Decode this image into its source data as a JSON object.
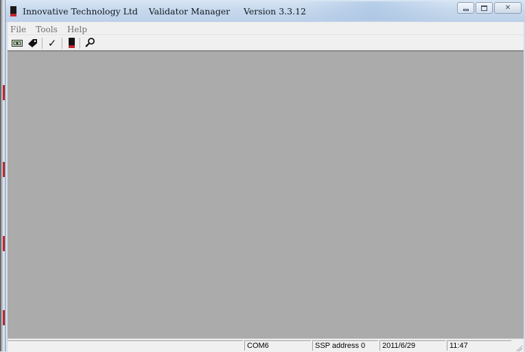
{
  "window": {
    "title": "Innovative Technology Ltd    Validator Manager     Version 3.3.12"
  },
  "caption_buttons": {
    "minimize_icon": "minimize-icon",
    "maximize_icon": "maximize-icon",
    "close_glyph": "✕"
  },
  "menu": {
    "items": [
      {
        "label": "File"
      },
      {
        "label": "Tools"
      },
      {
        "label": "Help"
      }
    ]
  },
  "toolbar": {
    "icons": [
      "banknote-icon",
      "tag-icon",
      "checkmark-icon",
      "validator-device-icon",
      "search-key-icon"
    ],
    "check_glyph": "✓"
  },
  "statusbar": {
    "panes": [
      {
        "text": ""
      },
      {
        "text": "COM6"
      },
      {
        "text": "SSP address 0"
      },
      {
        "text": "2011/6/29"
      },
      {
        "text": "11:47"
      }
    ]
  },
  "colors": {
    "client_area": "#ababab",
    "accent_red": "#c0272d"
  }
}
